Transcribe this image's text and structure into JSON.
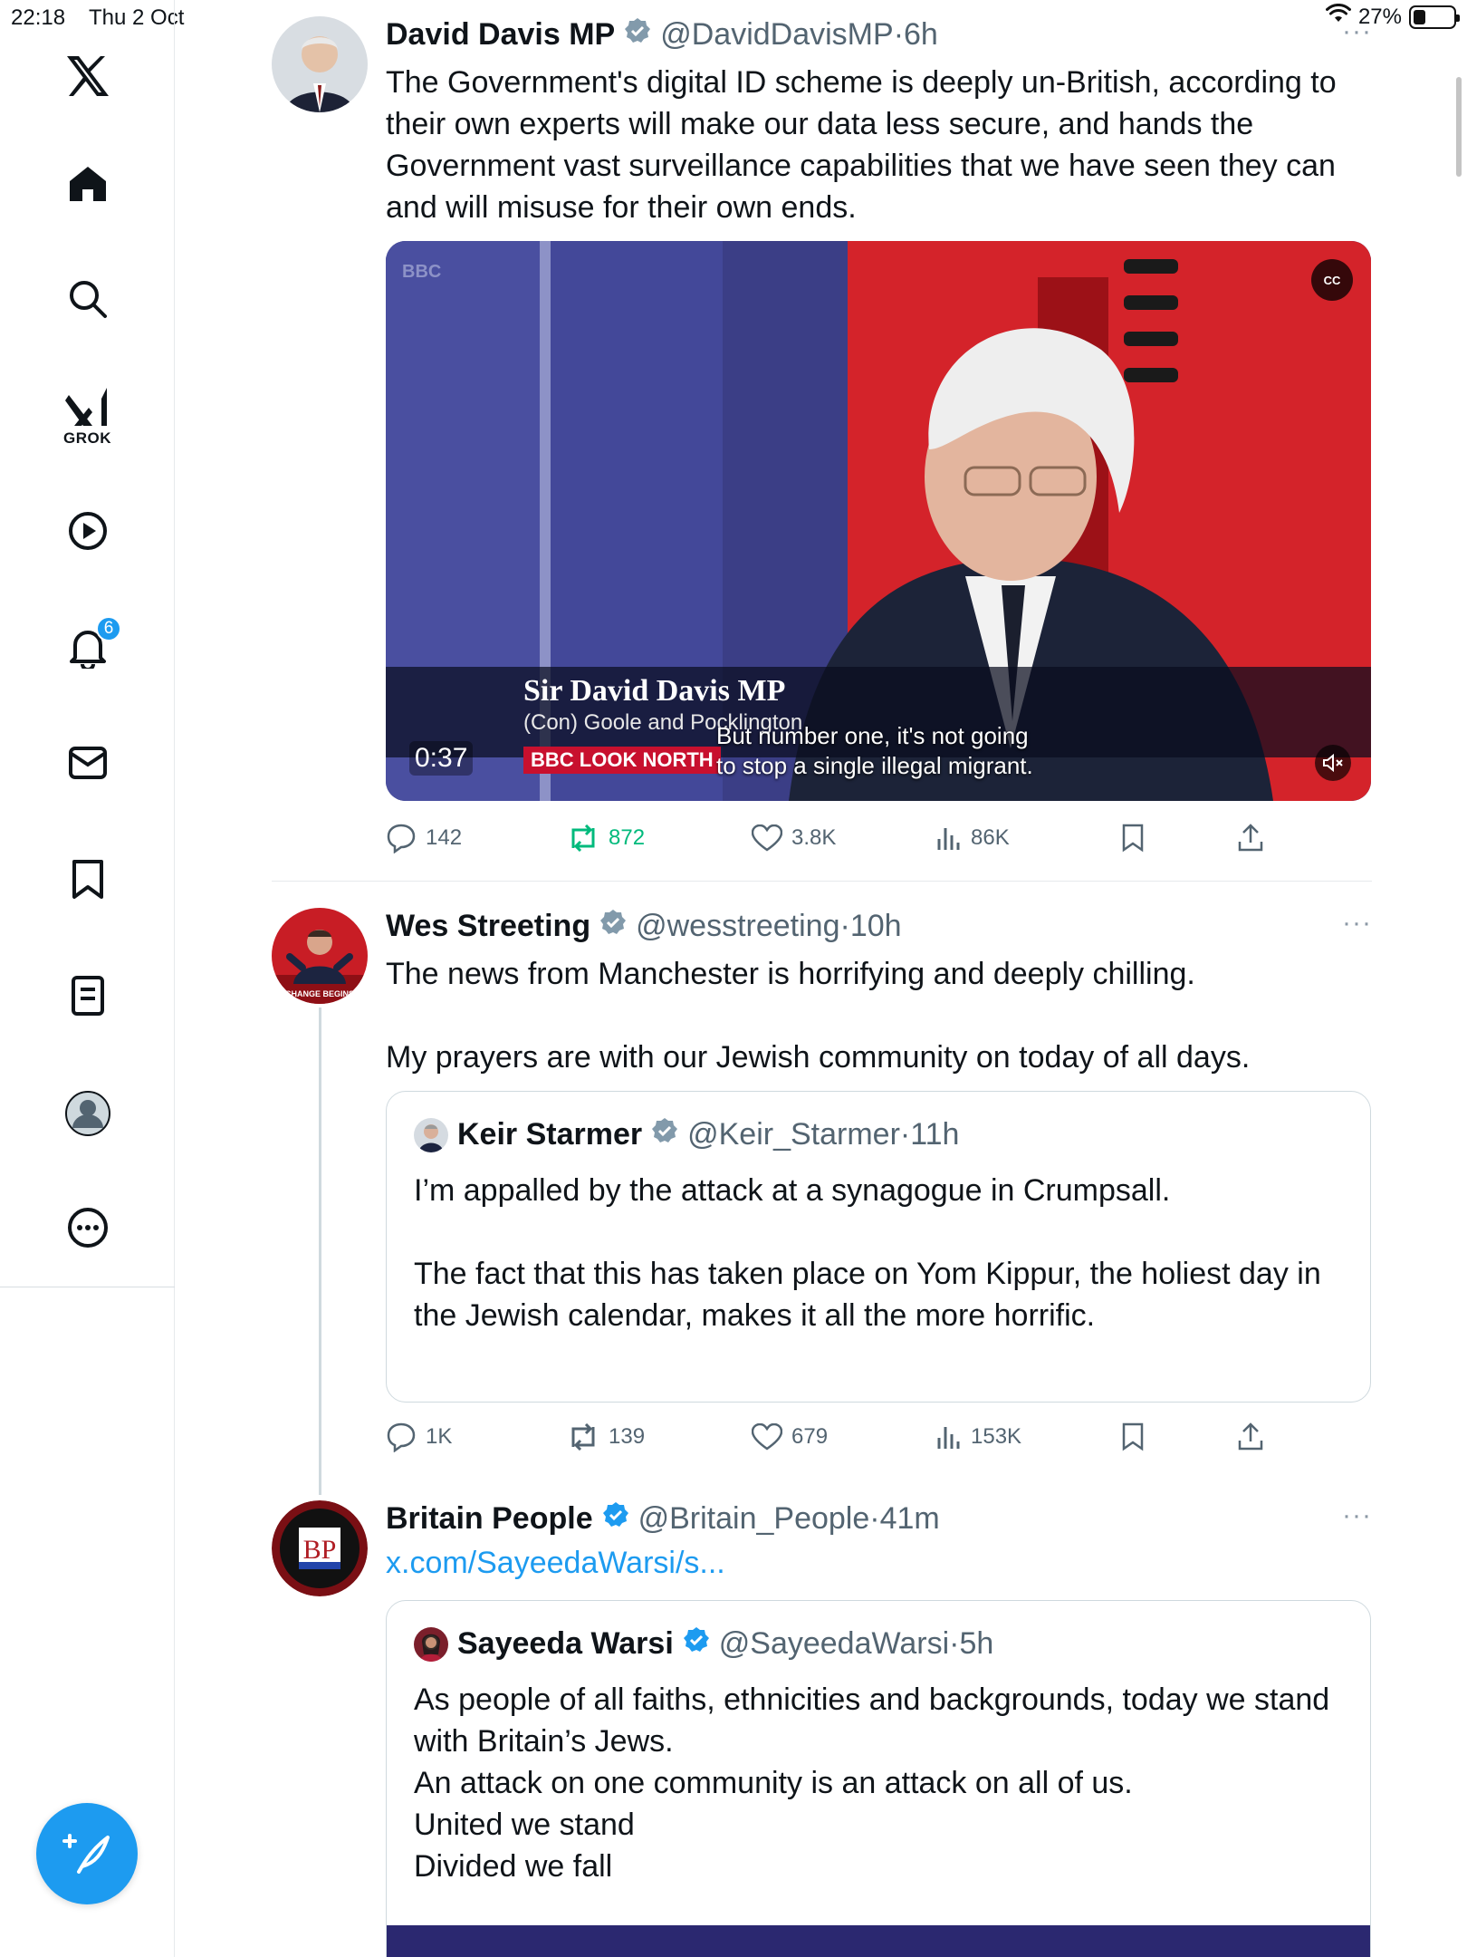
{
  "status_bar": {
    "time": "22:18",
    "date": "Thu 2 Oct",
    "battery": "27%",
    "battery_level": 0.27
  },
  "sidebar": {
    "grok_label": "GROK",
    "notifications_count": "6"
  },
  "feed": {
    "tweets": [
      {
        "name": "David Davis MP",
        "handle": "@DavidDavisMP",
        "dot": "·",
        "time": "6h",
        "text": "The Government's digital ID scheme is deeply un-British, according to their own experts will make our data less secure, and hands the Government vast surveillance capabilities that we have seen they can and will misuse for their own ends.",
        "video": {
          "duration": "0:37",
          "lower_third_name": "Sir David Davis MP",
          "lower_third_sub": "(Con) Goole and Pocklington",
          "programme": "BBC LOOK NORTH",
          "caption_line1": "But number one, it's not going",
          "caption_line2": "to stop a single illegal migrant.",
          "cc": "CC"
        },
        "stats": {
          "replies": "142",
          "reposts": "872",
          "likes": "3.8K",
          "views": "86K"
        }
      },
      {
        "name": "Wes Streeting",
        "handle": "@wesstreeting",
        "dot": "·",
        "time": "10h",
        "text": "The news from Manchester is horrifying and deeply chilling.\n\nMy prayers are with our Jewish community on today of all days.",
        "quote": {
          "name": "Keir Starmer",
          "handle": "@Keir_Starmer",
          "dot": "·",
          "time": "11h",
          "text": "I’m appalled by the attack at a synagogue in Crumpsall.\n\nThe fact that this has taken place on Yom Kippur, the holiest day in the Jewish calendar, makes it all the more horrific."
        },
        "stats": {
          "replies": "1K",
          "reposts": "139",
          "likes": "679",
          "views": "153K"
        }
      },
      {
        "name": "Britain People",
        "handle": "@Britain_People",
        "dot": "·",
        "time": "41m",
        "avatar_text": "BP",
        "link": "x.com/SayeedaWarsi/s...",
        "quote": {
          "name": "Sayeeda Warsi",
          "handle": "@SayeedaWarsi",
          "dot": "·",
          "time": "5h",
          "text": "As people of all faiths, ethnicities and backgrounds, today we stand with Britain’s Jews.\nAn attack on one community is an attack on all of us.\nUnited we stand\nDivided we fall"
        }
      }
    ]
  },
  "more_label": "···"
}
